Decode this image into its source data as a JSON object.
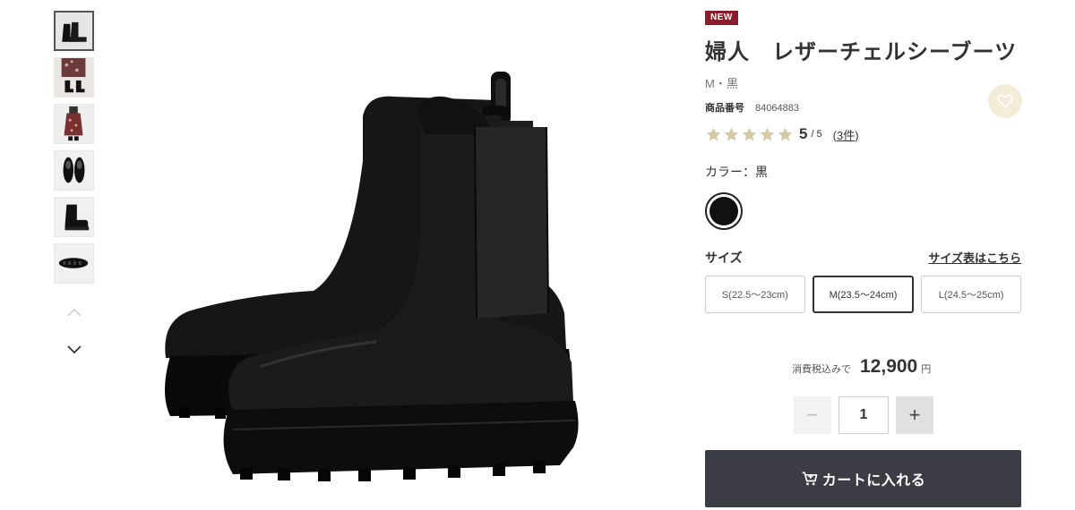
{
  "product": {
    "badge": "NEW",
    "title": "婦人　レザーチェルシーブーツ",
    "subtitle": "M・黒",
    "id_label": "商品番号",
    "id_value": "84064883",
    "rating": {
      "score": "5",
      "slash": "/",
      "max": "5",
      "stars_filled": 5,
      "stars_total": 5,
      "reviews": "(3件)"
    },
    "favorite_icon": "heart-icon"
  },
  "color": {
    "label": "カラー：黒",
    "selected": "黒",
    "swatch_hex": "#111111"
  },
  "size": {
    "label": "サイズ",
    "chart_link": "サイズ表はこちら",
    "options": [
      "S(22.5〜23cm)",
      "M(23.5〜24cm)",
      "L(24.5〜25cm)"
    ],
    "selected": "M(23.5〜24cm)"
  },
  "price": {
    "label": "消費税込みで",
    "value": "12,900",
    "unit": "円"
  },
  "quantity": {
    "minus": "−",
    "value": "1",
    "plus": "+"
  },
  "cart": {
    "label": "カートに入れる",
    "icon": "cart-icon"
  },
  "thumbnails": {
    "count": 6,
    "selected_index": 0
  },
  "colors": {
    "badge": "#8c1c2a",
    "cart_button": "#3c3c45",
    "star": "#d6c9a8",
    "favorite_bg": "#f3ecd9"
  }
}
